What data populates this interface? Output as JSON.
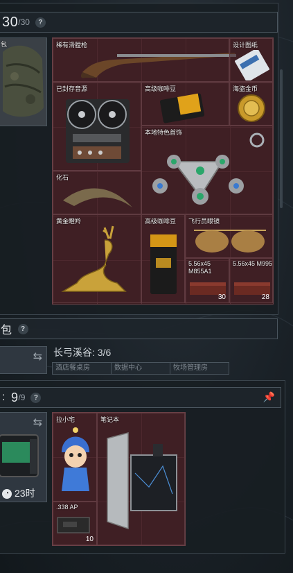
{
  "top_header": {
    "count": "30",
    "capacity": "/30",
    "help": "?"
  },
  "bag_partial_label": "包",
  "items_top": [
    {
      "id": "rifle",
      "label": "稀有滑膛枪"
    },
    {
      "id": "design",
      "label": "设计图纸"
    },
    {
      "id": "tape",
      "label": "已封存音源"
    },
    {
      "id": "coffee1",
      "label": "高级咖啡豆"
    },
    {
      "id": "gold",
      "label": "海盗金币"
    },
    {
      "id": "jewel",
      "label": "本地特色首饰"
    },
    {
      "id": "fossil",
      "label": "化石"
    },
    {
      "id": "deer",
      "label": "黄金瞪羚"
    },
    {
      "id": "coffee2",
      "label": "高级咖啡豆"
    },
    {
      "id": "glasses",
      "label": "飞行员眼镜"
    },
    {
      "id": "ammo1",
      "label": "5.56x45 M855A1",
      "count": "30"
    },
    {
      "id": "ammo2",
      "label": "5.56x45 M995",
      "count": "28"
    }
  ],
  "middle_header": {
    "label": "包",
    "help": "?"
  },
  "map_status": {
    "text": "长弓溪谷: 3/6"
  },
  "map_tabs": [
    "酒店餐桌房",
    "数据中心",
    "牧场管理房"
  ],
  "bottom_header": {
    "label": ":",
    "count": "9",
    "capacity": "/9",
    "help": "?"
  },
  "case_timer": "23时",
  "items_bottom": [
    {
      "id": "doll",
      "label": "拉小宅"
    },
    {
      "id": "laptop",
      "label": "笔记本"
    },
    {
      "id": "ammo338",
      "label": ".338 AP",
      "count": "10"
    }
  ],
  "colors": {
    "grid_bg": "#3d1e22",
    "grid_line": "#5b3238",
    "panel_bg": "#181e23"
  }
}
